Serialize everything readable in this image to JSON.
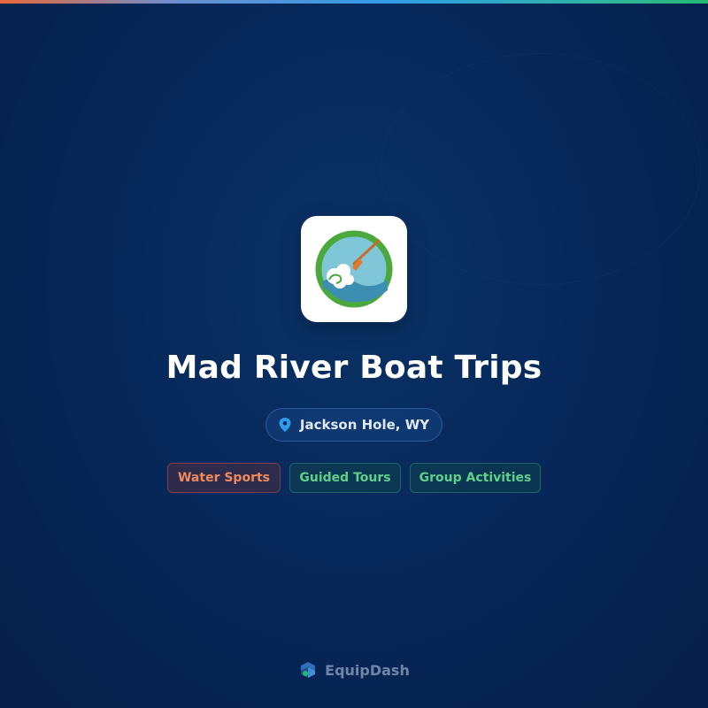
{
  "business": {
    "name": "Mad River Boat Trips",
    "location": "Jackson Hole, WY"
  },
  "tags": [
    {
      "label": "Water Sports",
      "color": "#f08a5d"
    },
    {
      "label": "Guided Tours",
      "color": "#5fd08a"
    },
    {
      "label": "Group Activities",
      "color": "#5fd08a"
    }
  ],
  "brand": {
    "name": "EquipDash"
  },
  "icons": {
    "logo": "river-paddle-logo",
    "location": "map-pin-icon",
    "brand": "equipdash-logo-icon"
  },
  "colors": {
    "background": "#07285a",
    "accent_blue": "#2f9be8",
    "accent_orange": "#e8693a",
    "accent_green": "#27b872"
  }
}
